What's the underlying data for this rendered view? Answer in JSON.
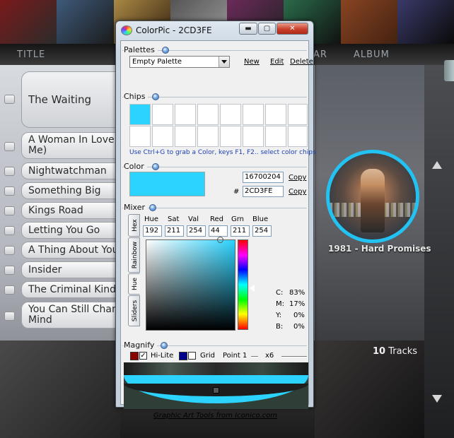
{
  "background_app": {
    "columns": [
      "TITLE",
      "AR",
      "ALBUM"
    ],
    "tracks": [
      "The Waiting",
      "A Woman In Love (It's Not\nMe)",
      "Nightwatchman",
      "Something Big",
      "Kings Road",
      "Letting You Go",
      "A Thing About You",
      "Insider",
      "The Criminal Kind",
      "You Can Still Change Your\nMind"
    ],
    "album_caption": "1981 - Hard Promises",
    "track_count": "10",
    "track_count_label": "Tracks",
    "accent_color": "#22c3f2"
  },
  "window": {
    "title": "ColorPic - 2CD3FE",
    "buttons": {
      "minimize": "▬",
      "maximize": "▢",
      "close": "✕"
    }
  },
  "palettes": {
    "title": "Palettes",
    "selected": "Empty Palette",
    "new_label": "New",
    "edit_label": "Edit",
    "delete_label": "Delete"
  },
  "chips": {
    "title": "Chips",
    "hint": "Use Ctrl+G to grab a Color, keys F1, F2.. select color chips",
    "first_color": "#2cd3fe"
  },
  "color": {
    "title": "Color",
    "decimal": "16700204",
    "hash": "#",
    "hex": "2CD3FE",
    "copy_label": "Copy",
    "swatch": "#2cd3fe"
  },
  "mixer": {
    "title": "Mixer",
    "tabs": [
      "Hex",
      "Rainbow",
      "Hue",
      "Sliders"
    ],
    "labels": [
      "Hue",
      "Sat",
      "Val",
      "Red",
      "Grn",
      "Blue"
    ],
    "values": [
      "192",
      "211",
      "254",
      "44",
      "211",
      "254"
    ],
    "cmyk": [
      {
        "k": "C:",
        "v": "83%"
      },
      {
        "k": "M:",
        "v": "17%"
      },
      {
        "k": "Y:",
        "v": "0%"
      },
      {
        "k": "B:",
        "v": "0%"
      }
    ]
  },
  "magnify": {
    "title": "Magnify",
    "hilite_label": "Hi-Lite",
    "hilite_color": "#8b0000",
    "grid_label": "Grid",
    "grid_color": "#00008b",
    "point_label": "Point 1",
    "zoom_label": "x6"
  },
  "footer": "Graphic Art Tools from Iconico.com"
}
